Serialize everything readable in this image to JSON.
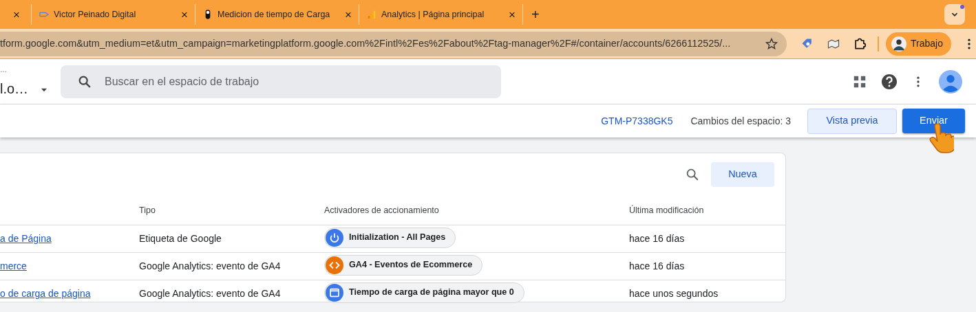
{
  "browser": {
    "tabs": [
      {
        "kind": "partial",
        "close": "×"
      },
      {
        "kind": "tag",
        "title": "Victor Peinado Digital",
        "close": "×"
      },
      {
        "kind": "toggle",
        "title": "Medicion de tiempo de Carga",
        "close": "×"
      },
      {
        "kind": "analytics",
        "title": "Analytics | Página principal",
        "close": "×"
      }
    ],
    "new_tab": "+",
    "address": "tform.google.com&utm_medium=et&utm_campaign=marketingplatform.google.com%2Fintl%2Fes%2Fabout%2Ftag-manager%2F#/container/accounts/6266112525/...",
    "profile": "Trabajo"
  },
  "header": {
    "account_dots": "…",
    "container_name": "l.o…",
    "search": {
      "placeholder": "Buscar en el espacio de trabajo"
    }
  },
  "subheader": {
    "container_id": "GTM-P7338GK5",
    "changes": "Cambios del espacio: 3",
    "buttons": [
      "Vista previa",
      "Enviar"
    ]
  },
  "tags": {
    "new_button": "Nueva",
    "columns": [
      "Tipo",
      "Activadores de accionamiento",
      "Última modificación"
    ],
    "rows": [
      {
        "name": "a de Página",
        "type": "Etiqueta de Google",
        "trigger": {
          "kind": "power",
          "color": "#3b78e7",
          "label": "Initialization - All Pages"
        },
        "modified": "hace 16 días"
      },
      {
        "name": "merce",
        "type": "Google Analytics: evento de GA4",
        "trigger": {
          "kind": "code",
          "color": "#e8710a",
          "label": "GA4 - Eventos de Ecommerce"
        },
        "modified": "hace 16 días"
      },
      {
        "name": "o de carga de página",
        "type": "Google Analytics: evento de GA4",
        "trigger": {
          "kind": "window",
          "color": "#3b78e7",
          "label": "Tiempo de carga de página mayor que 0"
        },
        "modified": "hace unos segundos"
      }
    ]
  }
}
